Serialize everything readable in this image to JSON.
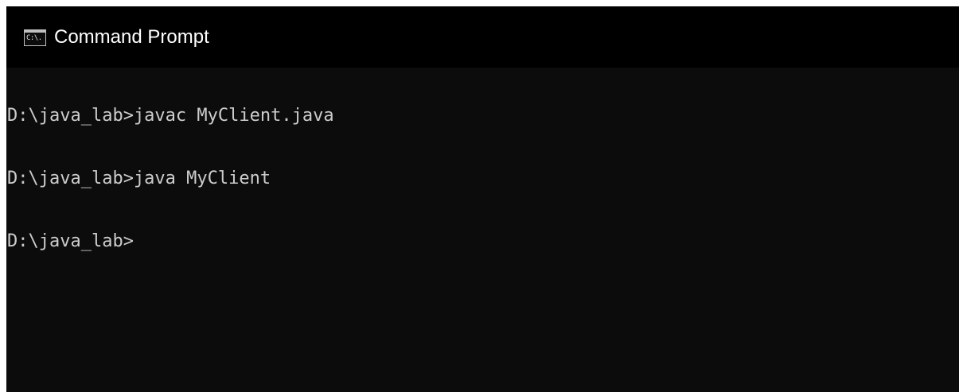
{
  "window": {
    "title": "Command Prompt",
    "icon": "console-icon",
    "icon_glyph": "C:\\."
  },
  "console": {
    "lines": [
      "D:\\java_lab>javac MyClient.java",
      "D:\\java_lab>java MyClient",
      "D:\\java_lab>"
    ]
  },
  "colors": {
    "titlebar_bg": "#000000",
    "console_bg": "#0c0c0c",
    "console_text": "#cccccc",
    "title_text": "#ffffff"
  }
}
